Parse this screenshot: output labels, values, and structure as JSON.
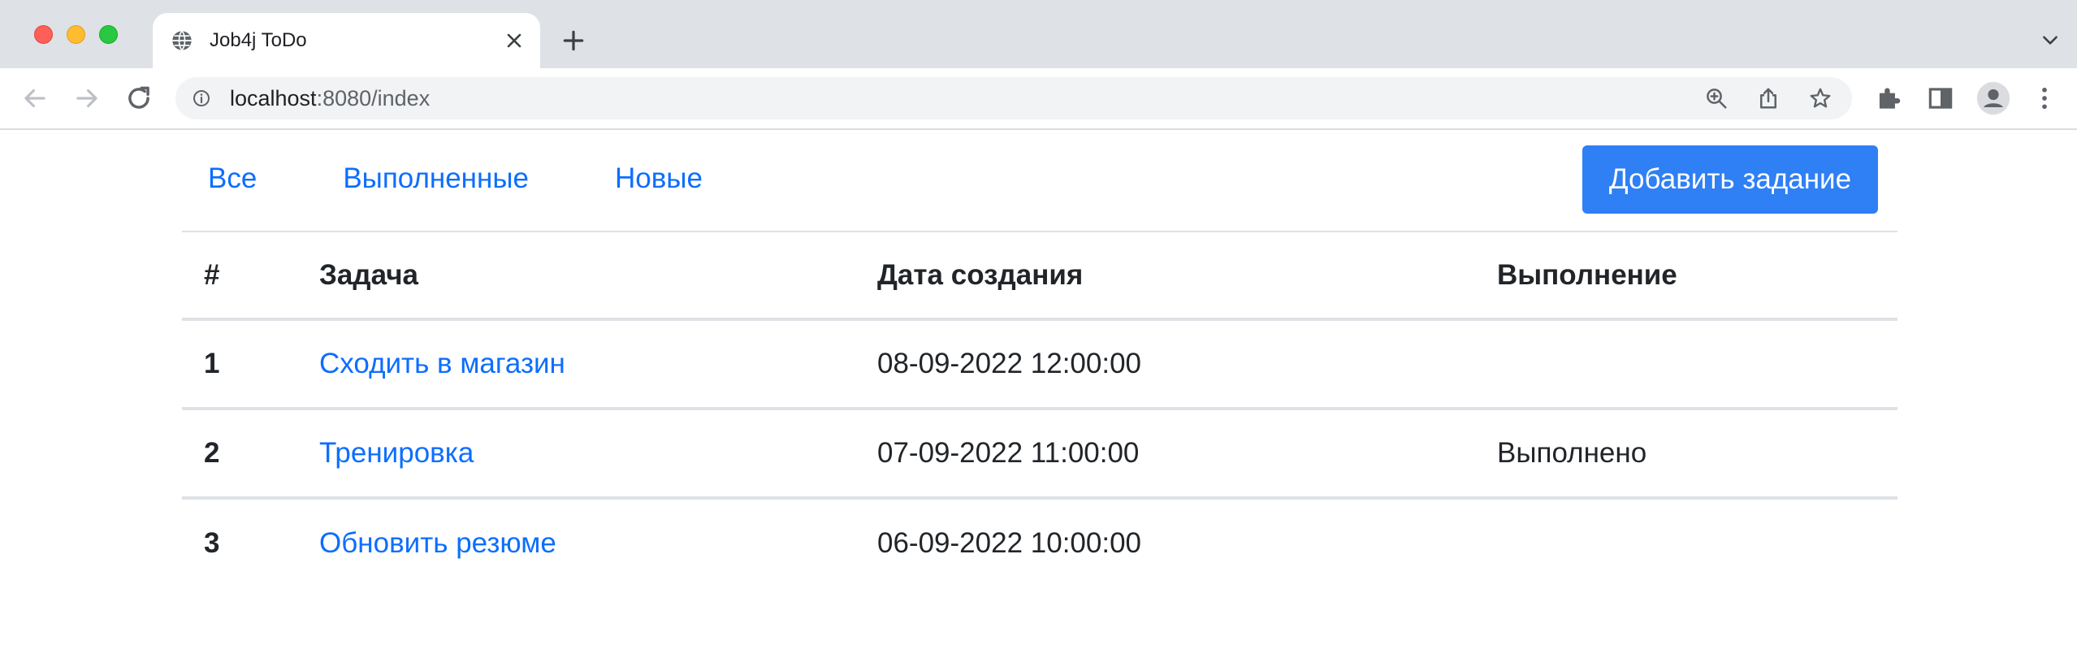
{
  "browser": {
    "tab_title": "Job4j ToDo",
    "url_host": "localhost",
    "url_rest": ":8080/index"
  },
  "icons": {
    "tab_favicon": "globe-icon",
    "tab_close": "close-icon",
    "new_tab": "plus-icon",
    "tab_search": "chevron-down-icon",
    "back": "arrow-left-icon",
    "forward": "arrow-right-icon",
    "reload": "reload-icon",
    "site_info": "info-icon",
    "zoom": "zoom-in-icon",
    "share": "share-icon",
    "bookmark": "star-icon",
    "extensions": "puzzle-icon",
    "side_panel": "side-panel-icon",
    "profile": "profile-icon",
    "menu": "kebab-menu-icon"
  },
  "nav": {
    "all": "Все",
    "done": "Выполненные",
    "new": "Новые"
  },
  "add_button": "Добавить задание",
  "table": {
    "headers": [
      "#",
      "Задача",
      "Дата создания",
      "Выполнение"
    ],
    "rows": [
      {
        "num": "1",
        "task": "Сходить в магазин",
        "created": "08-09-2022 12:00:00",
        "status": ""
      },
      {
        "num": "2",
        "task": "Тренировка",
        "created": "07-09-2022 11:00:00",
        "status": "Выполнено"
      },
      {
        "num": "3",
        "task": "Обновить резюме",
        "created": "06-09-2022 10:00:00",
        "status": ""
      }
    ]
  },
  "colors": {
    "link": "#0d6efd",
    "button": "#2f7ff5",
    "tabstrip": "#dee1e6"
  }
}
